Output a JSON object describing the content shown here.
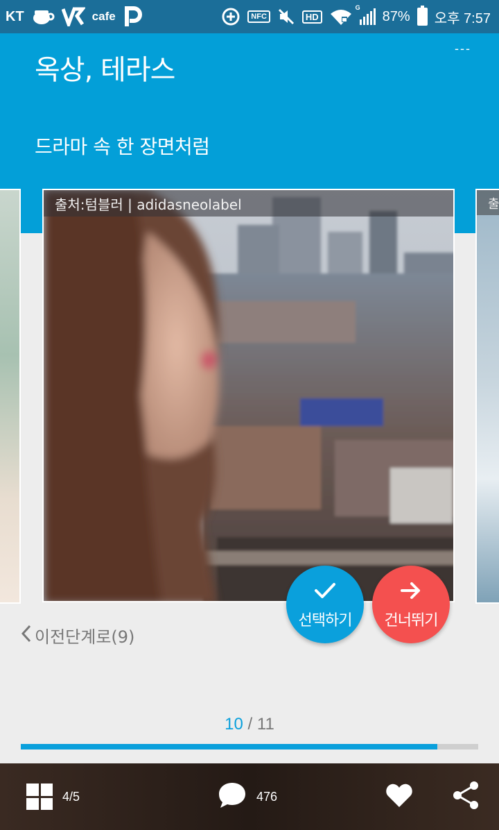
{
  "status_bar": {
    "carrier": "KT",
    "cafe_label": "cafe",
    "nfc_label": "NFC",
    "hd_label": "HD",
    "network_label": "G",
    "battery_percent": "87%",
    "time": "오후 7:57"
  },
  "header": {
    "title": "옥상, 테라스",
    "subtitle": "드라마 속 한 장면처럼",
    "menu_label": "---",
    "background_color": "#039fd8"
  },
  "card": {
    "source_caption": "출처:텀블러 | adidasneolabel",
    "next_card_caption": "출"
  },
  "actions": {
    "select_label": "선택하기",
    "skip_label": "건너뛰기",
    "select_color": "#0aa0dc",
    "skip_color": "#f4504f"
  },
  "navigation": {
    "previous_step_label": "이전단계로(9)"
  },
  "progress": {
    "current": "10",
    "separator": " / ",
    "total": "11",
    "fraction": 0.91
  },
  "bottom_bar": {
    "grid_count": "4/5",
    "comment_count": "476",
    "icons": [
      "grid-icon",
      "comment-icon",
      "heart-icon",
      "share-icon"
    ]
  }
}
